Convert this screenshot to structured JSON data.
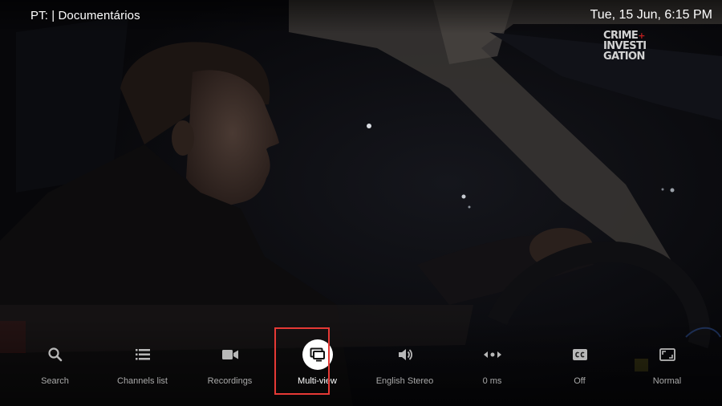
{
  "header": {
    "channel_title": "PT: | Documentários",
    "datetime": "Tue, 15 Jun, 6:15 PM"
  },
  "channel_logo": {
    "line1": "CRIME",
    "plus": "+",
    "line2": "INVESTI",
    "line3": "GATION"
  },
  "menu": {
    "selected_index": 3,
    "items": [
      {
        "label": "Search",
        "icon": "search-icon"
      },
      {
        "label": "Channels list",
        "icon": "list-icon"
      },
      {
        "label": "Recordings",
        "icon": "video-camera-icon"
      },
      {
        "label": "Multi-view",
        "icon": "multi-view-icon"
      },
      {
        "label": "English Stereo",
        "icon": "speaker-icon"
      },
      {
        "label": "0 ms",
        "icon": "audio-delay-icon"
      },
      {
        "label": "Off",
        "icon": "closed-captions-icon"
      },
      {
        "label": "Normal",
        "icon": "aspect-ratio-icon"
      }
    ]
  },
  "colors": {
    "focus_border": "#e53935",
    "label_inactive": "#a9a9a9",
    "label_active": "#ffffff"
  }
}
